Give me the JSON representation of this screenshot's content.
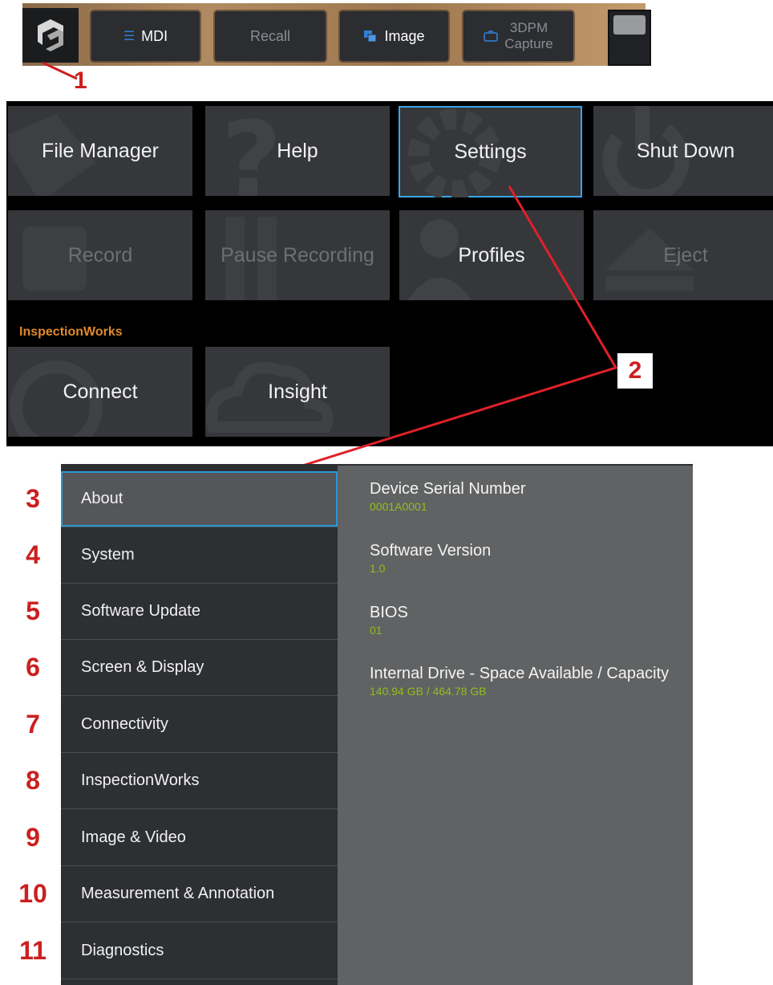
{
  "toolbar": {
    "mdi_label": "MDI",
    "recall_label": "Recall",
    "image_label": "Image",
    "capture_line1": "3DPM",
    "capture_line2": "Capture"
  },
  "callouts": [
    "1",
    "2",
    "3",
    "4",
    "5",
    "6",
    "7",
    "8",
    "9",
    "10",
    "11"
  ],
  "menu": {
    "tiles": [
      {
        "label": "File Manager",
        "state": "enabled"
      },
      {
        "label": "Help",
        "state": "enabled"
      },
      {
        "label": "Settings",
        "state": "selected"
      },
      {
        "label": "Shut Down",
        "state": "enabled"
      },
      {
        "label": "Record",
        "state": "disabled"
      },
      {
        "label": "Pause Recording",
        "state": "disabled"
      },
      {
        "label": "Profiles",
        "state": "enabled"
      },
      {
        "label": "Eject",
        "state": "disabled"
      }
    ],
    "section_label": "InspectionWorks",
    "iw_tiles": [
      {
        "label": "Connect"
      },
      {
        "label": "Insight"
      }
    ]
  },
  "settings": {
    "nav": [
      {
        "label": "About",
        "active": true
      },
      {
        "label": "System"
      },
      {
        "label": "Software Update"
      },
      {
        "label": "Screen & Display"
      },
      {
        "label": "Connectivity"
      },
      {
        "label": "InspectionWorks"
      },
      {
        "label": "Image & Video"
      },
      {
        "label": "Measurement & Annotation"
      },
      {
        "label": "Diagnostics"
      }
    ],
    "about": [
      {
        "label": "Device Serial Number",
        "value": "0001A0001"
      },
      {
        "label": "Software Version",
        "value": "1.0"
      },
      {
        "label": "BIOS",
        "value": "01"
      },
      {
        "label": "Internal Drive - Space Available / Capacity",
        "value": "140.94 GB / 464.78 GB"
      }
    ]
  },
  "colors": {
    "accent_blue": "#38a6e8",
    "callout_red": "#cc1f1f",
    "section_orange": "#e0892a",
    "value_green": "#8fbf1a"
  }
}
